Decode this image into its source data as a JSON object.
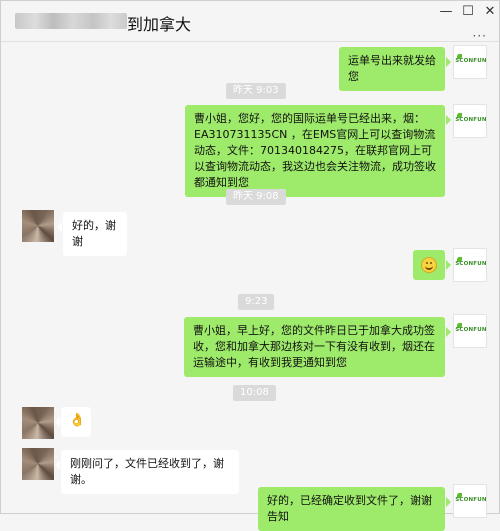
{
  "window": {
    "title": "到加拿大",
    "controls": {
      "minimize": "—",
      "maximize": "☐",
      "close": "✕"
    },
    "more": "···"
  },
  "brand_avatar_text": "SCONFUN",
  "timestamps": [
    "昨天 9:03",
    "昨天 9:08",
    "9:23",
    "10:08"
  ],
  "messages": [
    {
      "side": "right",
      "text": "运单号出来就发给您"
    },
    {
      "side": "right",
      "text": "曹小姐，您好，您的国际运单号已经出来，烟：EA310731135CN ，在EMS官网上可以查询物流动态，文件：701340184275，在联邦官网上可以查询物流动态，我这边也会关注物流，成功签收 都通知到您"
    },
    {
      "side": "left",
      "text": "好的，谢谢"
    },
    {
      "side": "right",
      "emoji": "smile-emoji"
    },
    {
      "side": "right",
      "text": "曹小姐，早上好，您的文件昨日已于加拿大成功签收，您和加拿大那边核对一下有没有收到，烟还在运输途中，有收到我更通知到您"
    },
    {
      "side": "left",
      "emoji": "ok-hand-emoji"
    },
    {
      "side": "left",
      "text": "刚刚问了，文件已经收到了，谢谢。"
    },
    {
      "side": "right",
      "text": "好的，已经确定收到文件了，谢谢告知"
    }
  ]
}
